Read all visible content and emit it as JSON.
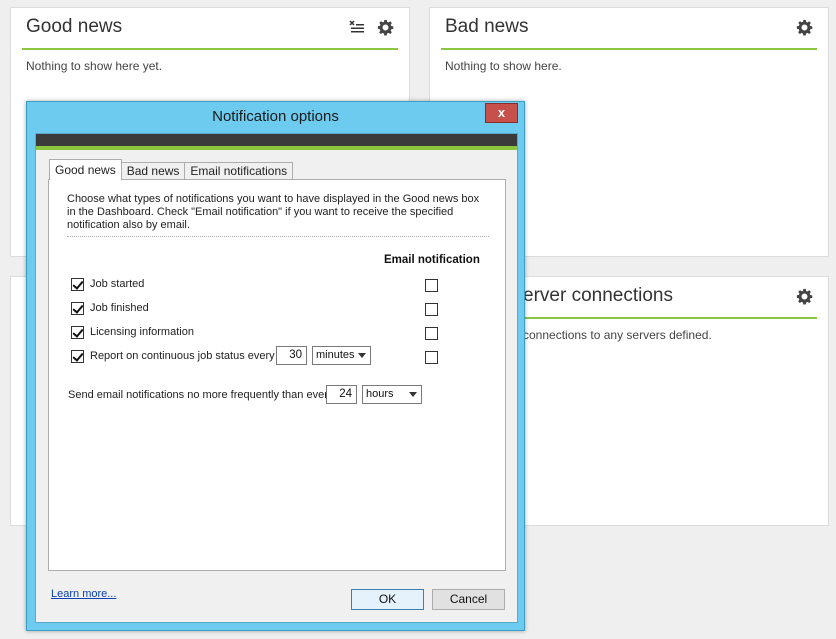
{
  "panels": {
    "good_news": {
      "title": "Good news",
      "empty_text": "Nothing to show here yet."
    },
    "bad_news": {
      "title": "Bad news",
      "empty_text": "Nothing to show here."
    },
    "servers": {
      "title_visible": "erver connections",
      "text_visible": "connections to any servers defined."
    }
  },
  "dialog": {
    "title": "Notification options",
    "close_label": "x",
    "tabs": [
      "Good news",
      "Bad news",
      "Email notifications"
    ],
    "description": "Choose what types of notifications you want to have displayed in the Good news box in the Dashboard. Check \"Email notification\" if you want to receive the specified notification also by email.",
    "email_column_header": "Email notification",
    "rows": [
      {
        "label": "Job started",
        "checked": true,
        "email": false
      },
      {
        "label": "Job finished",
        "checked": true,
        "email": false
      },
      {
        "label": "Licensing information",
        "checked": true,
        "email": false
      },
      {
        "label": "Report on continuous job status every",
        "checked": true,
        "email": false
      }
    ],
    "job_status_interval": {
      "value": "30",
      "unit": "minutes"
    },
    "email_frequency": {
      "label": "Send email notifications no more frequently than every",
      "value": "24",
      "unit": "hours"
    },
    "learn_more": "Learn more...",
    "ok_label": "OK",
    "cancel_label": "Cancel"
  },
  "colors": {
    "accent": "#8cc63f",
    "title_bar": "#6ccbee",
    "close": "#c7504a"
  }
}
